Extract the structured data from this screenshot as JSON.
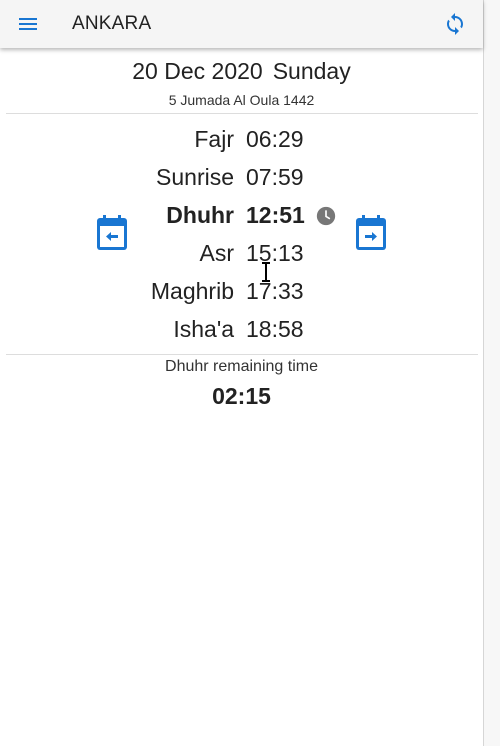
{
  "app": {
    "city": "ANKARA"
  },
  "date": {
    "gregorian": "20 Dec 2020",
    "weekday": "Sunday",
    "hijri": "5 Jumada Al Oula 1442"
  },
  "prayers": [
    {
      "name": "Fajr",
      "time": "06:29"
    },
    {
      "name": "Sunrise",
      "time": "07:59"
    },
    {
      "name": "Dhuhr",
      "time": "12:51",
      "active": true
    },
    {
      "name": "Asr",
      "time": "15:13"
    },
    {
      "name": "Maghrib",
      "time": "17:33"
    },
    {
      "name": "Isha'a",
      "time": "18:58"
    }
  ],
  "remaining": {
    "label": "Dhuhr remaining time",
    "value": "02:15"
  },
  "icons": {
    "menu": "menu-icon",
    "refresh": "refresh-icon",
    "clock": "clock-icon",
    "previous_day": "calendar-previous-icon",
    "next_day": "calendar-next-icon"
  },
  "colors": {
    "accent": "#1976d2",
    "clock": "#777777",
    "toolbar": "#f5f5f5"
  }
}
